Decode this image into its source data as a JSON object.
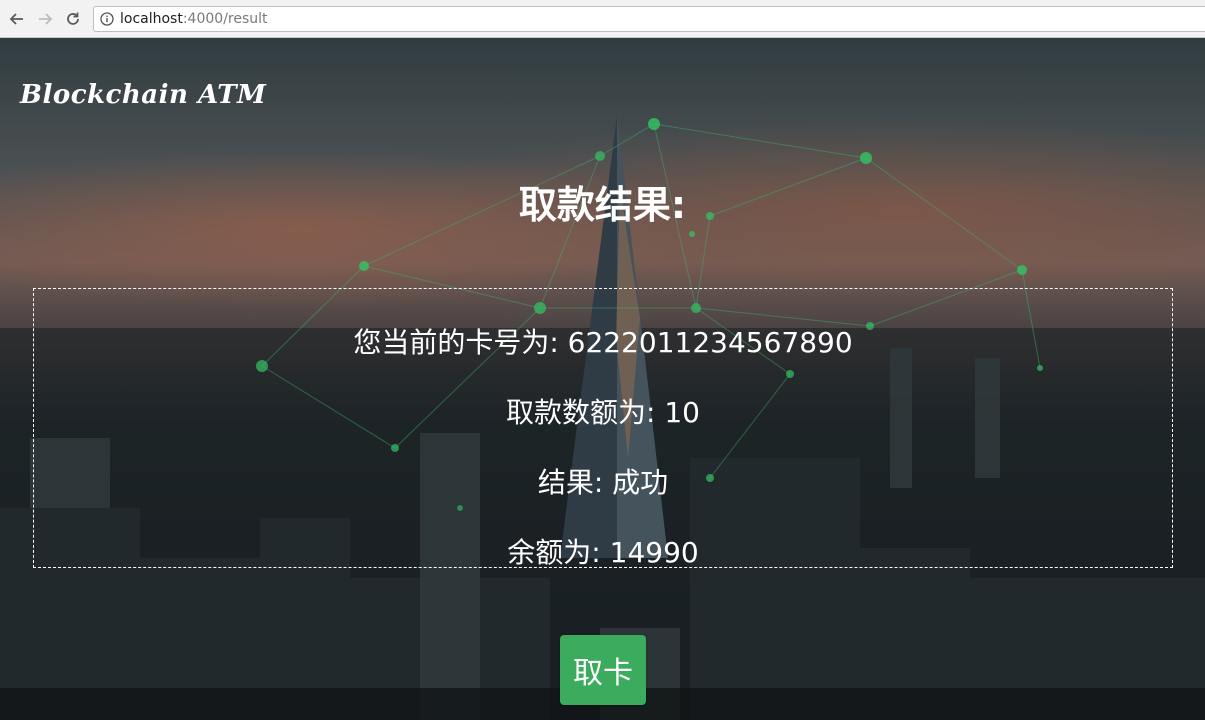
{
  "browser": {
    "url_host": "localhost",
    "url_path": ":4000/result"
  },
  "page": {
    "brand": "Blockchain ATM",
    "title": "取款结果:",
    "result": {
      "card_label": "您当前的卡号为:",
      "card_number": "6222011234567890",
      "amount_label": "取款数额为:",
      "amount": "10",
      "status_label": "结果:",
      "status": "成功",
      "balance_label": "余额为:",
      "balance": "14990"
    },
    "take_card_button": "取卡"
  },
  "colors": {
    "button": "#3bab5d",
    "text": "#ffffff",
    "network_glow": "#3ef07a"
  }
}
